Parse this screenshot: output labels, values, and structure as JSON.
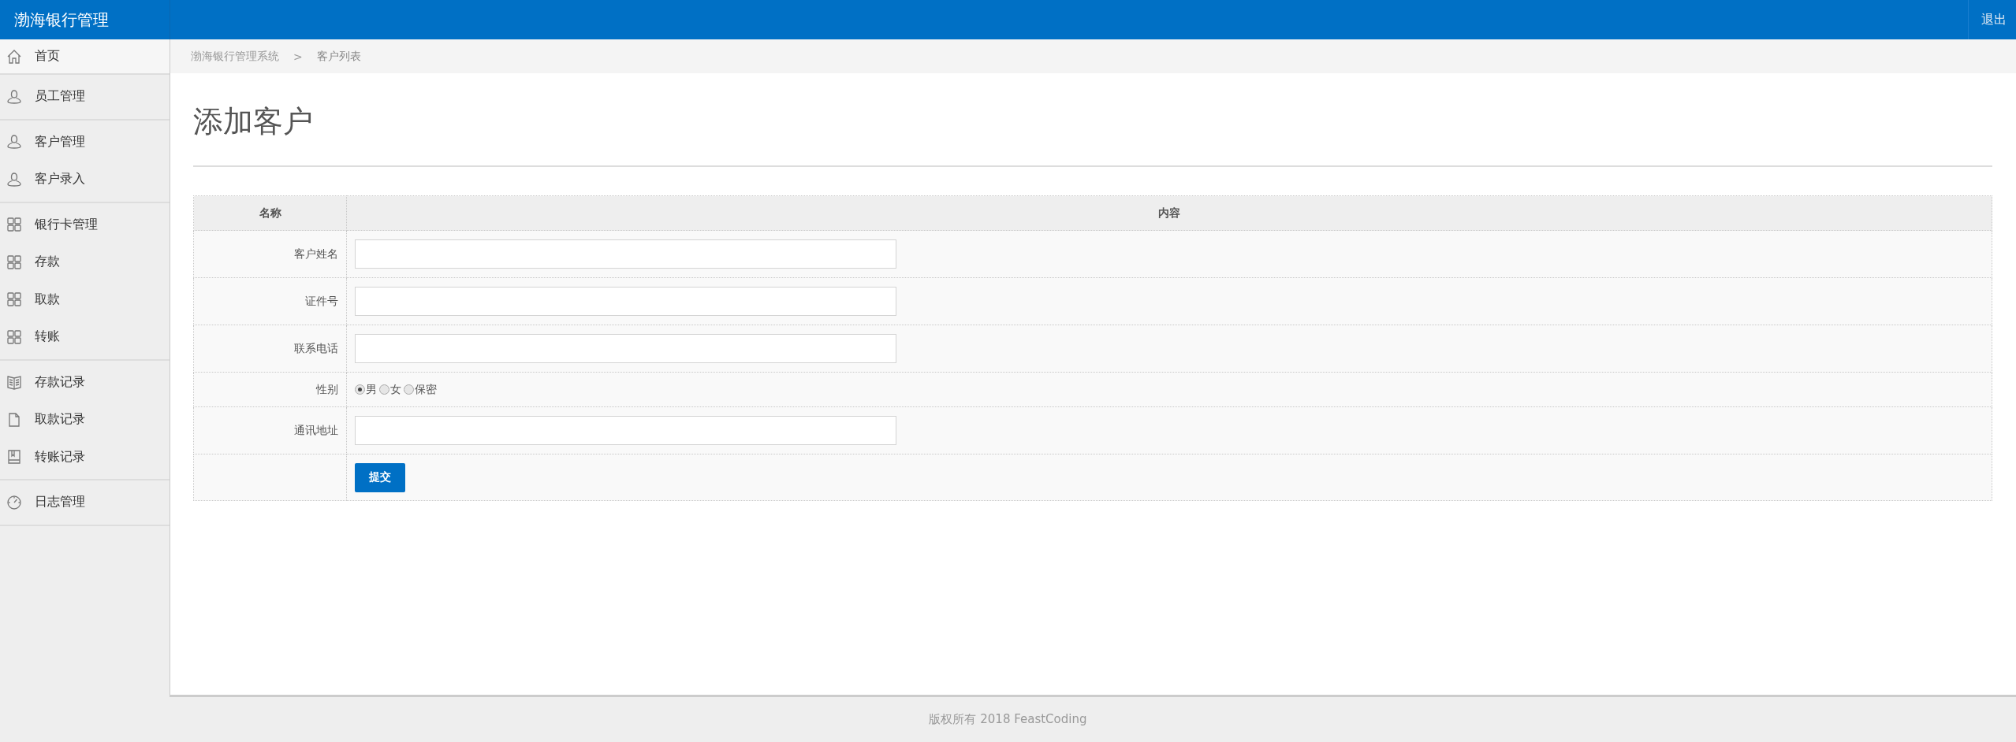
{
  "header": {
    "title": "渤海银行管理",
    "logout": "退出"
  },
  "sidebar": {
    "groups": [
      {
        "items": [
          {
            "label": "首页",
            "kind": "home"
          }
        ]
      },
      {
        "items": [
          {
            "label": "员工管理",
            "kind": "user"
          }
        ]
      },
      {
        "items": [
          {
            "label": "客户管理",
            "kind": "user"
          },
          {
            "label": "客户录入",
            "kind": "user"
          }
        ]
      },
      {
        "items": [
          {
            "label": "银行卡管理",
            "kind": "grid"
          },
          {
            "label": "存款",
            "kind": "grid"
          },
          {
            "label": "取款",
            "kind": "grid"
          },
          {
            "label": "转账",
            "kind": "grid"
          }
        ]
      },
      {
        "items": [
          {
            "label": "存款记录",
            "kind": "book"
          },
          {
            "label": "取款记录",
            "kind": "file"
          },
          {
            "label": "转账记录",
            "kind": "notebook"
          }
        ]
      },
      {
        "items": [
          {
            "label": "日志管理",
            "kind": "gauge"
          }
        ]
      }
    ]
  },
  "breadcrumb": [
    "渤海银行管理系统",
    "客户列表"
  ],
  "breadcrumb_separator": ">",
  "page_title": "添加客户",
  "form_table": {
    "columns": [
      "名称",
      "内容"
    ],
    "rows": [
      {
        "kind": "text",
        "label": "客户姓名"
      },
      {
        "kind": "text",
        "label": "证件号"
      },
      {
        "kind": "text",
        "label": "联系电话"
      },
      {
        "kind": "radio",
        "label": "性别",
        "options": [
          {
            "label": "男",
            "selected": true
          },
          {
            "label": "女",
            "selected": false
          },
          {
            "label": "保密",
            "selected": false
          }
        ]
      },
      {
        "kind": "text",
        "label": "通讯地址"
      },
      {
        "kind": "submit",
        "button": "提交"
      }
    ]
  },
  "footer": "版权所有 2018 FeastCoding"
}
